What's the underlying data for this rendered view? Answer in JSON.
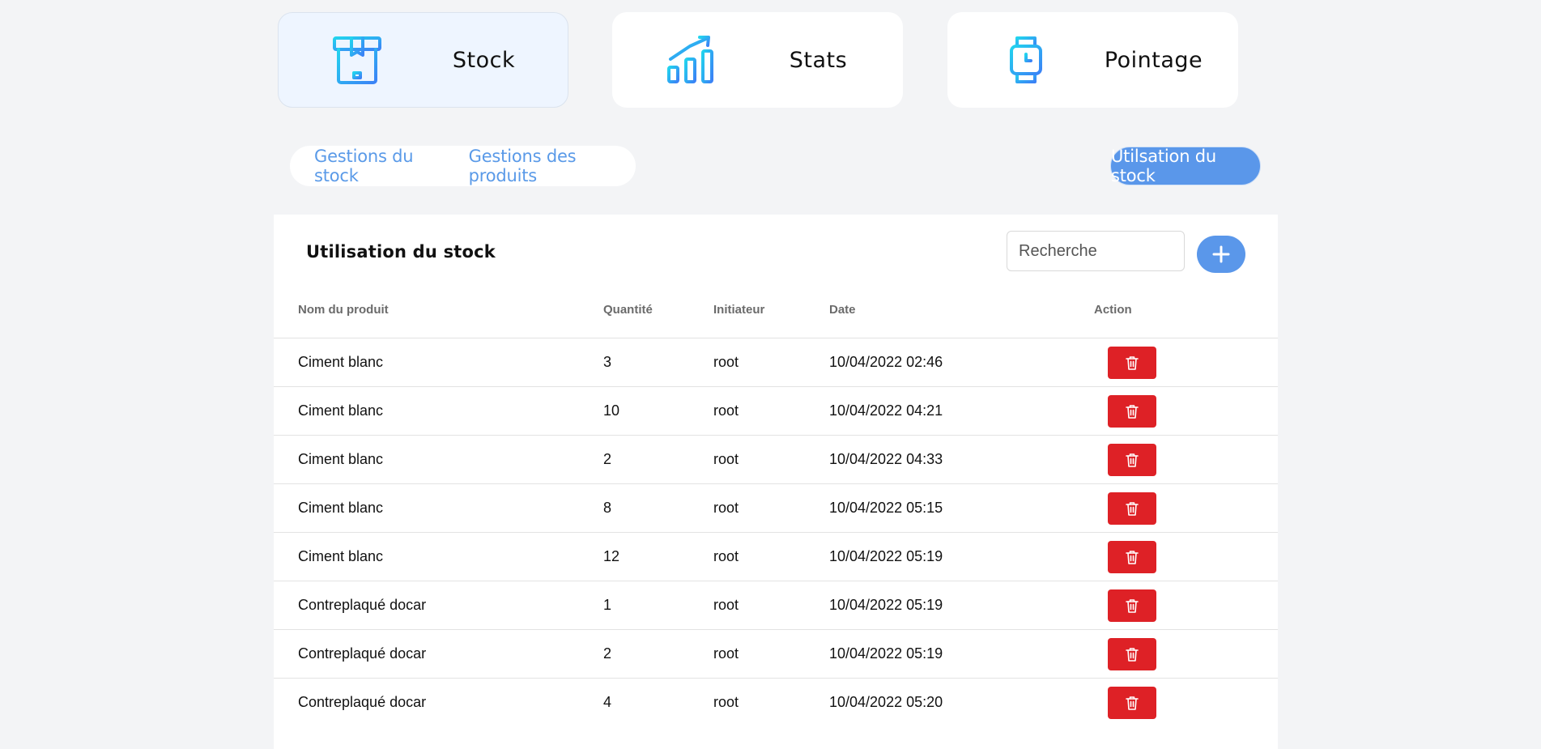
{
  "nav_cards": [
    {
      "label": "Stock",
      "icon": "box-icon"
    },
    {
      "label": "Stats",
      "icon": "chart-icon"
    },
    {
      "label": "Pointage",
      "icon": "watch-icon"
    }
  ],
  "subnav": {
    "tabs": [
      "Gestions du stock",
      "Gestions des produits"
    ],
    "active_pill": "Utilsation du stock"
  },
  "panel": {
    "title": "Utilisation du stock",
    "search_placeholder": "Recherche",
    "add_label": "+"
  },
  "table": {
    "headers": [
      "Nom du produit",
      "Quantité",
      "Initiateur",
      "Date",
      "Action"
    ],
    "rows": [
      [
        "Ciment blanc",
        "3",
        "root",
        "10/04/2022 02:46"
      ],
      [
        "Ciment blanc",
        "10",
        "root",
        "10/04/2022 04:21"
      ],
      [
        "Ciment blanc",
        "2",
        "root",
        "10/04/2022 04:33"
      ],
      [
        "Ciment blanc",
        "8",
        "root",
        "10/04/2022 05:15"
      ],
      [
        "Ciment blanc",
        "12",
        "root",
        "10/04/2022 05:19"
      ],
      [
        "Contreplaqué docar",
        "1",
        "root",
        "10/04/2022 05:19"
      ],
      [
        "Contreplaqué docar",
        "2",
        "root",
        "10/04/2022 05:19"
      ],
      [
        "Contreplaqué docar",
        "4",
        "root",
        "10/04/2022 05:20"
      ]
    ]
  },
  "colors": {
    "accent": "#5a97ea",
    "icon_gradient_start": "#22d3ee",
    "icon_gradient_end": "#3b82f6",
    "delete": "#de2126",
    "background": "#f3f4f6"
  }
}
